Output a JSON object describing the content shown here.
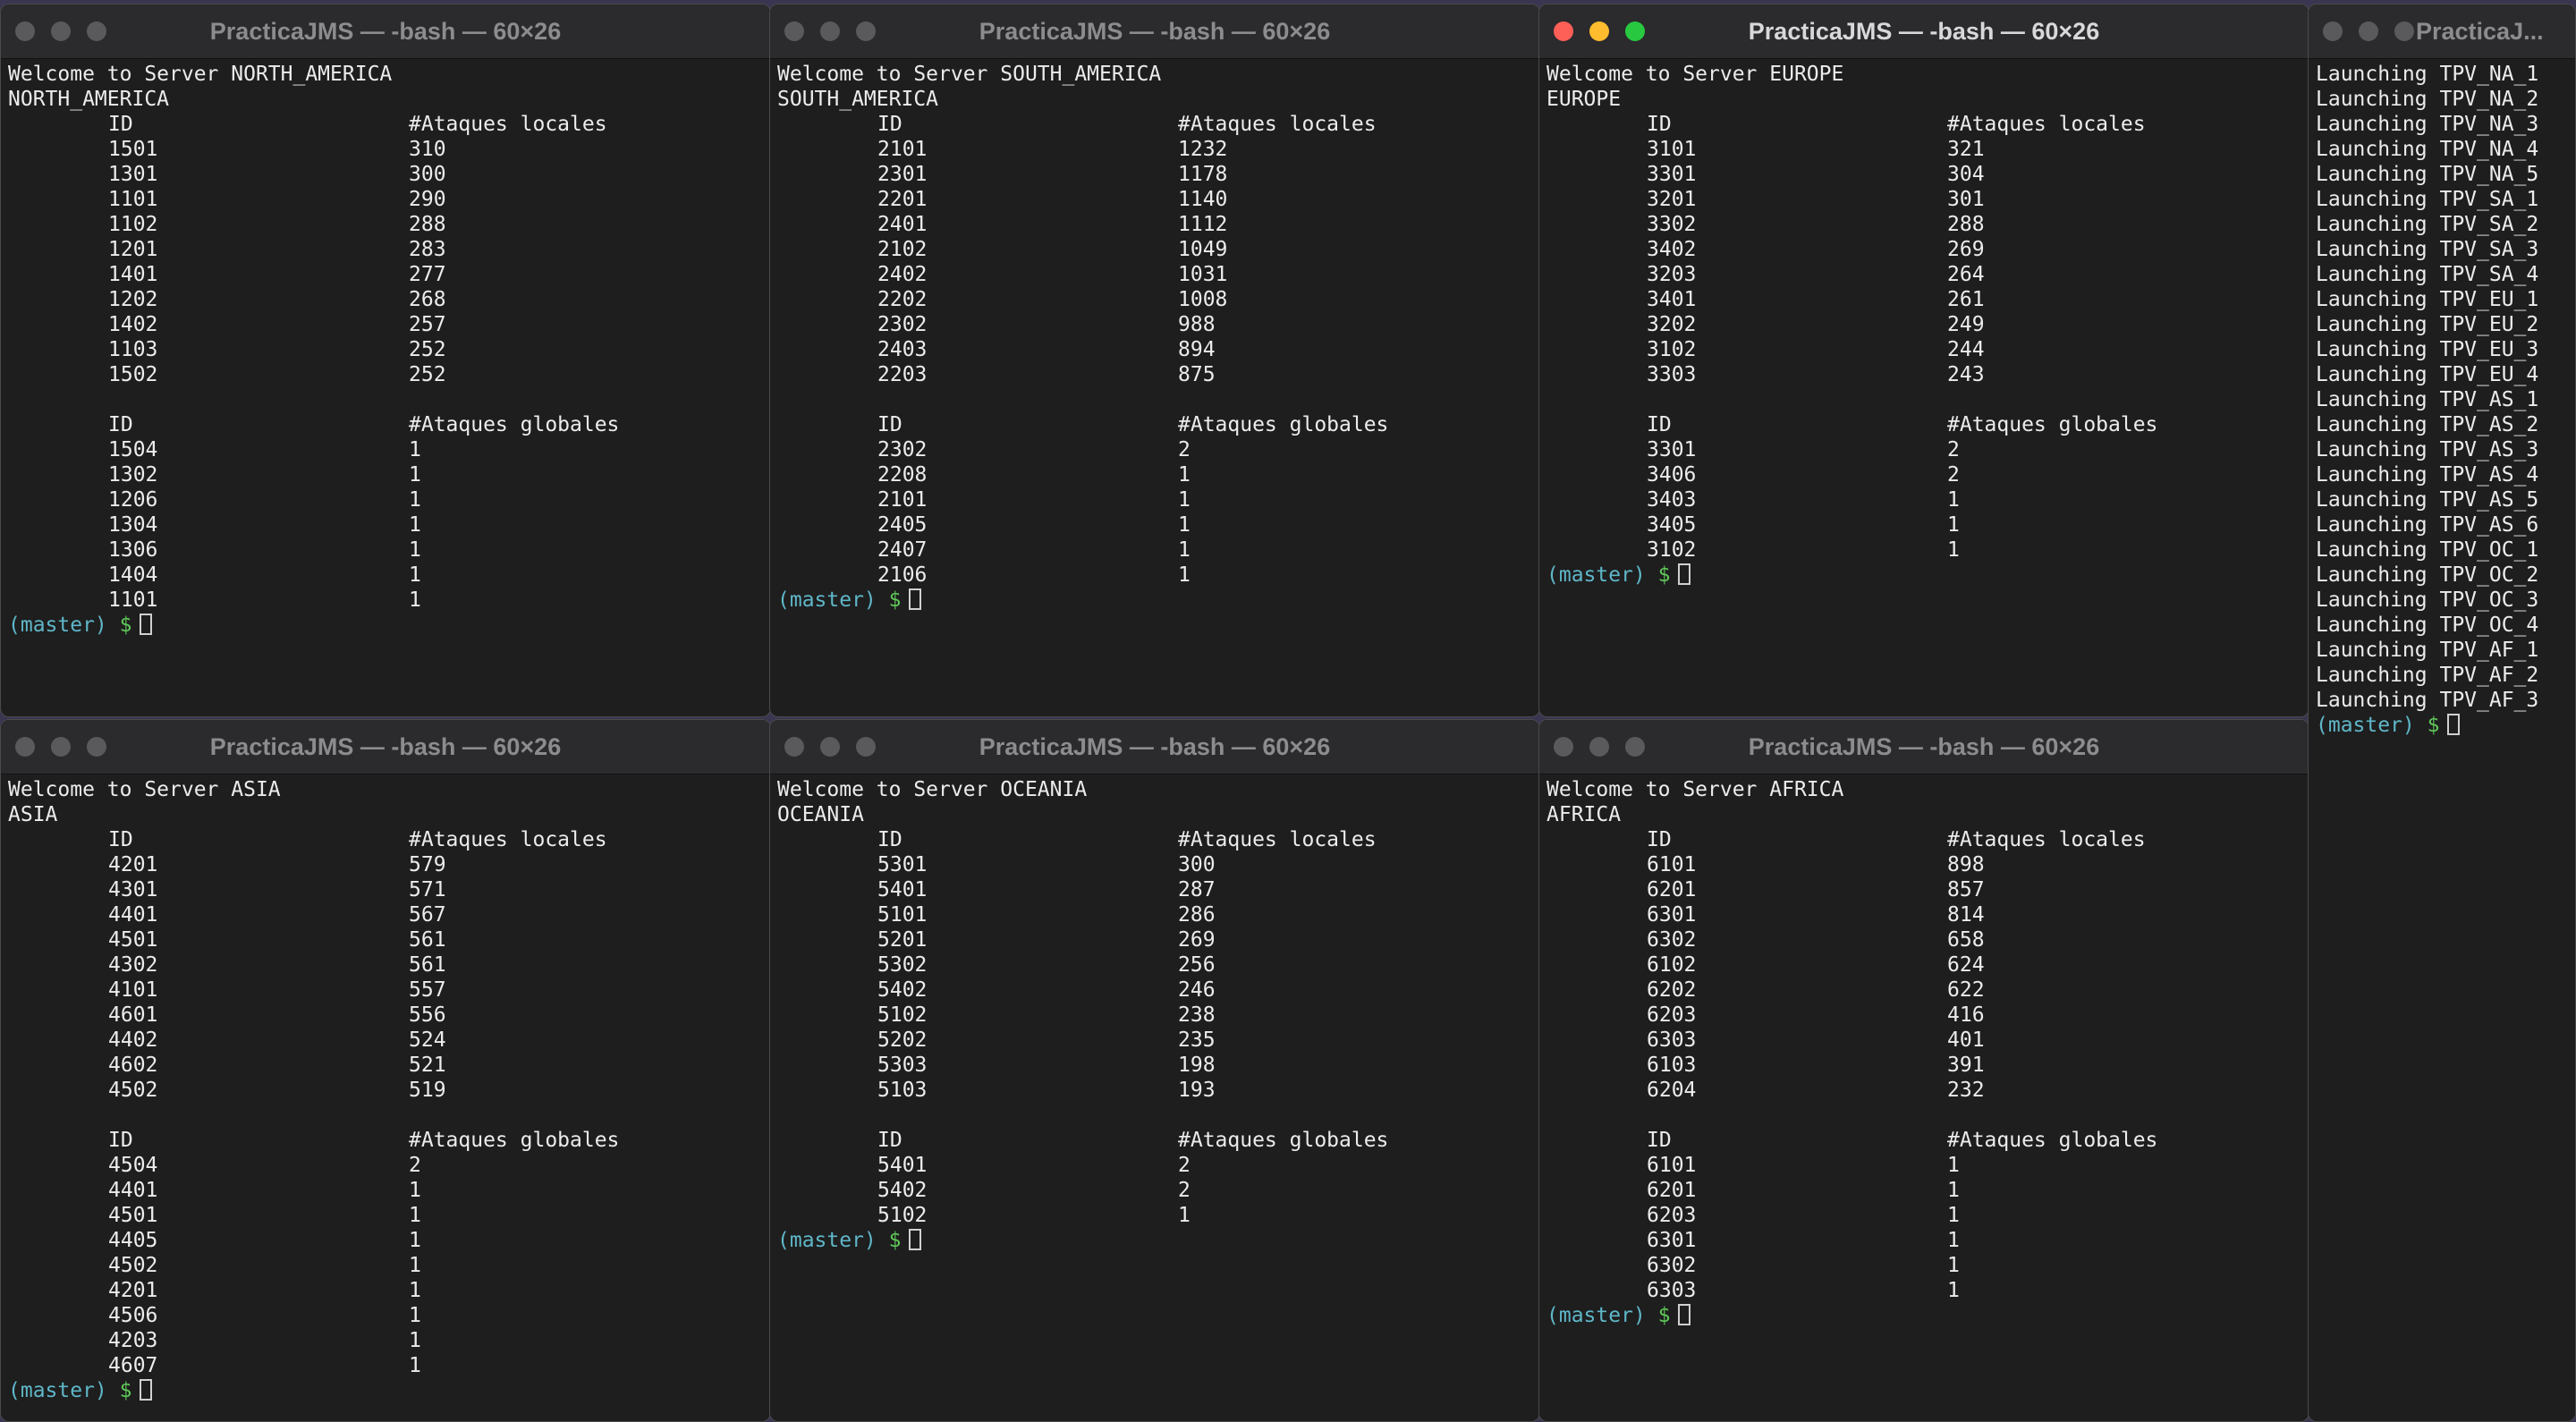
{
  "prompt": {
    "branch": "(master)",
    "symbol": "$"
  },
  "windows": [
    {
      "title": "PracticaJMS — -bash — 60×26",
      "welcome": "Welcome to Server NORTH_AMERICA",
      "region": "NORTH_AMERICA",
      "local_header": [
        "ID",
        "#Ataques locales"
      ],
      "local_rows": [
        [
          "1501",
          "310"
        ],
        [
          "1301",
          "300"
        ],
        [
          "1101",
          "290"
        ],
        [
          "1102",
          "288"
        ],
        [
          "1201",
          "283"
        ],
        [
          "1401",
          "277"
        ],
        [
          "1202",
          "268"
        ],
        [
          "1402",
          "257"
        ],
        [
          "1103",
          "252"
        ],
        [
          "1502",
          "252"
        ]
      ],
      "global_header": [
        "ID",
        "#Ataques globales"
      ],
      "global_rows": [
        [
          "1504",
          "1"
        ],
        [
          "1302",
          "1"
        ],
        [
          "1206",
          "1"
        ],
        [
          "1304",
          "1"
        ],
        [
          "1306",
          "1"
        ],
        [
          "1404",
          "1"
        ],
        [
          "1101",
          "1"
        ]
      ]
    },
    {
      "title": "PracticaJMS — -bash — 60×26",
      "welcome": "Welcome to Server SOUTH_AMERICA",
      "region": "SOUTH_AMERICA",
      "local_header": [
        "ID",
        "#Ataques locales"
      ],
      "local_rows": [
        [
          "2101",
          "1232"
        ],
        [
          "2301",
          "1178"
        ],
        [
          "2201",
          "1140"
        ],
        [
          "2401",
          "1112"
        ],
        [
          "2102",
          "1049"
        ],
        [
          "2402",
          "1031"
        ],
        [
          "2202",
          "1008"
        ],
        [
          "2302",
          "988"
        ],
        [
          "2403",
          "894"
        ],
        [
          "2203",
          "875"
        ]
      ],
      "global_header": [
        "ID",
        "#Ataques globales"
      ],
      "global_rows": [
        [
          "2302",
          "2"
        ],
        [
          "2208",
          "1"
        ],
        [
          "2101",
          "1"
        ],
        [
          "2405",
          "1"
        ],
        [
          "2407",
          "1"
        ],
        [
          "2106",
          "1"
        ]
      ]
    },
    {
      "title": "PracticaJMS — -bash — 60×26",
      "welcome": "Welcome to Server EUROPE",
      "region": "EUROPE",
      "local_header": [
        "ID",
        "#Ataques locales"
      ],
      "local_rows": [
        [
          "3101",
          "321"
        ],
        [
          "3301",
          "304"
        ],
        [
          "3201",
          "301"
        ],
        [
          "3302",
          "288"
        ],
        [
          "3402",
          "269"
        ],
        [
          "3203",
          "264"
        ],
        [
          "3401",
          "261"
        ],
        [
          "3202",
          "249"
        ],
        [
          "3102",
          "244"
        ],
        [
          "3303",
          "243"
        ]
      ],
      "global_header": [
        "ID",
        "#Ataques globales"
      ],
      "global_rows": [
        [
          "3301",
          "2"
        ],
        [
          "3406",
          "2"
        ],
        [
          "3403",
          "1"
        ],
        [
          "3405",
          "1"
        ],
        [
          "3102",
          "1"
        ]
      ]
    },
    {
      "title": "PracticaJMS — -bash — 60×26",
      "welcome": "Welcome to Server ASIA",
      "region": "ASIA",
      "local_header": [
        "ID",
        "#Ataques locales"
      ],
      "local_rows": [
        [
          "4201",
          "579"
        ],
        [
          "4301",
          "571"
        ],
        [
          "4401",
          "567"
        ],
        [
          "4501",
          "561"
        ],
        [
          "4302",
          "561"
        ],
        [
          "4101",
          "557"
        ],
        [
          "4601",
          "556"
        ],
        [
          "4402",
          "524"
        ],
        [
          "4602",
          "521"
        ],
        [
          "4502",
          "519"
        ]
      ],
      "global_header": [
        "ID",
        "#Ataques globales"
      ],
      "global_rows": [
        [
          "4504",
          "2"
        ],
        [
          "4401",
          "1"
        ],
        [
          "4501",
          "1"
        ],
        [
          "4405",
          "1"
        ],
        [
          "4502",
          "1"
        ],
        [
          "4201",
          "1"
        ],
        [
          "4506",
          "1"
        ],
        [
          "4203",
          "1"
        ],
        [
          "4607",
          "1"
        ]
      ]
    },
    {
      "title": "PracticaJMS — -bash — 60×26",
      "welcome": "Welcome to Server OCEANIA",
      "region": "OCEANIA",
      "local_header": [
        "ID",
        "#Ataques locales"
      ],
      "local_rows": [
        [
          "5301",
          "300"
        ],
        [
          "5401",
          "287"
        ],
        [
          "5101",
          "286"
        ],
        [
          "5201",
          "269"
        ],
        [
          "5302",
          "256"
        ],
        [
          "5402",
          "246"
        ],
        [
          "5102",
          "238"
        ],
        [
          "5202",
          "235"
        ],
        [
          "5303",
          "198"
        ],
        [
          "5103",
          "193"
        ]
      ],
      "global_header": [
        "ID",
        "#Ataques globales"
      ],
      "global_rows": [
        [
          "5401",
          "2"
        ],
        [
          "5402",
          "2"
        ],
        [
          "5102",
          "1"
        ]
      ]
    },
    {
      "title": "PracticaJMS — -bash — 60×26",
      "welcome": "Welcome to Server AFRICA",
      "region": "AFRICA",
      "local_header": [
        "ID",
        "#Ataques locales"
      ],
      "local_rows": [
        [
          "6101",
          "898"
        ],
        [
          "6201",
          "857"
        ],
        [
          "6301",
          "814"
        ],
        [
          "6302",
          "658"
        ],
        [
          "6102",
          "624"
        ],
        [
          "6202",
          "622"
        ],
        [
          "6203",
          "416"
        ],
        [
          "6303",
          "401"
        ],
        [
          "6103",
          "391"
        ],
        [
          "6204",
          "232"
        ]
      ],
      "global_header": [
        "ID",
        "#Ataques globales"
      ],
      "global_rows": [
        [
          "6101",
          "1"
        ],
        [
          "6201",
          "1"
        ],
        [
          "6203",
          "1"
        ],
        [
          "6301",
          "1"
        ],
        [
          "6302",
          "1"
        ],
        [
          "6303",
          "1"
        ]
      ]
    }
  ],
  "launcher": {
    "title": "PracticaJ...",
    "lines": [
      "Launching TPV_NA_1",
      "Launching TPV_NA_2",
      "Launching TPV_NA_3",
      "Launching TPV_NA_4",
      "Launching TPV_NA_5",
      "Launching TPV_SA_1",
      "Launching TPV_SA_2",
      "Launching TPV_SA_3",
      "Launching TPV_SA_4",
      "Launching TPV_EU_1",
      "Launching TPV_EU_2",
      "Launching TPV_EU_3",
      "Launching TPV_EU_4",
      "Launching TPV_AS_1",
      "Launching TPV_AS_2",
      "Launching TPV_AS_3",
      "Launching TPV_AS_4",
      "Launching TPV_AS_5",
      "Launching TPV_AS_6",
      "Launching TPV_OC_1",
      "Launching TPV_OC_2",
      "Launching TPV_OC_3",
      "Launching TPV_OC_4",
      "Launching TPV_AF_1",
      "Launching TPV_AF_2",
      "Launching TPV_AF_3"
    ]
  }
}
